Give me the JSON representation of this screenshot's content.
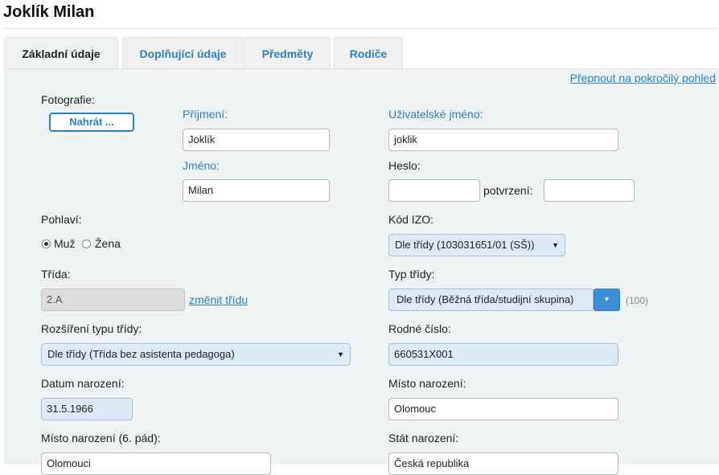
{
  "header": {
    "title": "Joklík Milan"
  },
  "tabs": [
    {
      "label": "Základní údaje",
      "active": true
    },
    {
      "label": "Doplňující údaje"
    },
    {
      "label": "Předměty"
    },
    {
      "label": "Rodiče"
    }
  ],
  "advanced_view_link": "Přepnout na pokročilý pohled",
  "photo": {
    "label": "Fotografie:",
    "upload_button": "Nahrát ..."
  },
  "surname": {
    "label": "Příjmení:",
    "value": "Joklík"
  },
  "firstname": {
    "label": "Jméno:",
    "value": "Milan"
  },
  "username": {
    "label": "Uživatelské jméno:",
    "value": "joklik"
  },
  "password": {
    "label": "Heslo:",
    "value": "",
    "confirm_label": "potvrzení:",
    "confirm_value": ""
  },
  "gender": {
    "label": "Pohlaví:",
    "options": [
      "Muž",
      "Žena"
    ],
    "selected": "Muž"
  },
  "izo": {
    "label": "Kód IZO:",
    "value": "Dle třídy (103031651/01 (SŠ))"
  },
  "class": {
    "label": "Třída:",
    "value": "2.A",
    "change_link": "změnit třídu"
  },
  "class_type": {
    "label": "Typ třídy:",
    "value": "Dle třídy (Běžná třída/studijní skupina)",
    "count": "(100)"
  },
  "class_type_ext": {
    "label": "Rozšíření typu třídy:",
    "value": "Dle třídy (Třída bez asistenta pedagoga)"
  },
  "birth_number": {
    "label": "Rodné číslo:",
    "value": "660531X001"
  },
  "birth_date": {
    "label": "Datum narození:",
    "value": "31.5.1966"
  },
  "birth_place": {
    "label": "Místo narození:",
    "value": "Olomouc"
  },
  "birth_place_locative": {
    "label": "Místo narození (6. pád):",
    "value": "Olomouci"
  },
  "birth_country": {
    "label": "Stát narození:",
    "value": "Česká republika"
  },
  "colors": {
    "link": "#2a83c5",
    "panel": "#eff2f3",
    "tinted_input": "#dde9f7",
    "dropdown_button": "#3a8fd6"
  }
}
